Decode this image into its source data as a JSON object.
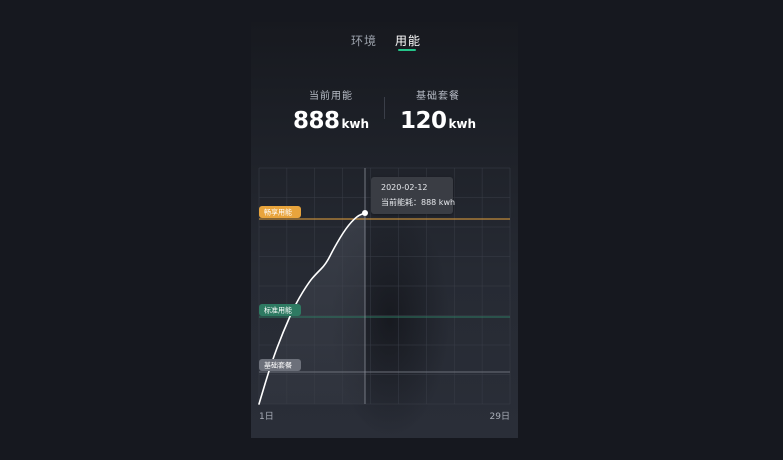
{
  "tabs": [
    {
      "label": "环境",
      "active": false
    },
    {
      "label": "用能",
      "active": true
    }
  ],
  "stats": [
    {
      "label": "当前用能",
      "value": "888",
      "unit": "kwh"
    },
    {
      "label": "基础套餐",
      "value": "120",
      "unit": "kwh"
    }
  ],
  "tooltip": {
    "date": "2020-02-12",
    "text": "当前能耗：888 kwh"
  },
  "chart_data": {
    "type": "line",
    "x_labels": {
      "start": "1日",
      "end": "29日"
    },
    "thresholds": [
      {
        "label": "畅享用能",
        "color": "#e8a43c"
      },
      {
        "label": "标准用能",
        "color": "#2e7a62"
      },
      {
        "label": "基础套餐",
        "color": "#6c707a"
      }
    ],
    "grid": true,
    "highlight": {
      "date": "2020-02-12",
      "value": 888,
      "unit": "kwh"
    }
  },
  "colors": {
    "accent": "#25c58a",
    "line": "#ffffff",
    "premium": "#e8a43c",
    "standard": "#2e7a62",
    "basic": "#6c707a"
  }
}
